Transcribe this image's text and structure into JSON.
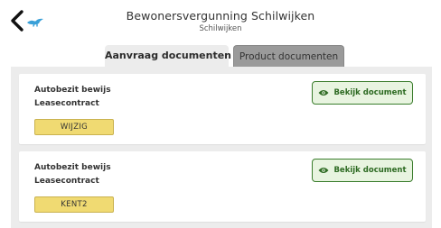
{
  "header": {
    "title": "Bewonersvergunning Schilwijken",
    "subtitle": "Schilwijken",
    "back_icon": "back-arrow-icon",
    "brand_icon": "bird-logo-icon"
  },
  "tabs": [
    {
      "label": "Aanvraag documenten",
      "active": true
    },
    {
      "label": "Product documenten",
      "active": false
    }
  ],
  "documents": [
    {
      "line1": "Autobezit bewijs",
      "line2": "Leasecontract",
      "badge": "WIJZIG",
      "button_label": "Bekijk document",
      "button_icon": "eye-icon"
    },
    {
      "line1": "Autobezit bewijs",
      "line2": "Leasecontract",
      "badge": "KENT2",
      "button_label": "Bekijk document",
      "button_icon": "eye-icon"
    }
  ],
  "colors": {
    "accent_green": "#2d6a22",
    "badge_yellow": "#f0da72",
    "brand_blue": "#3aa0d8",
    "tab_inactive": "#9a9a9a",
    "list_background": "#ececec"
  }
}
